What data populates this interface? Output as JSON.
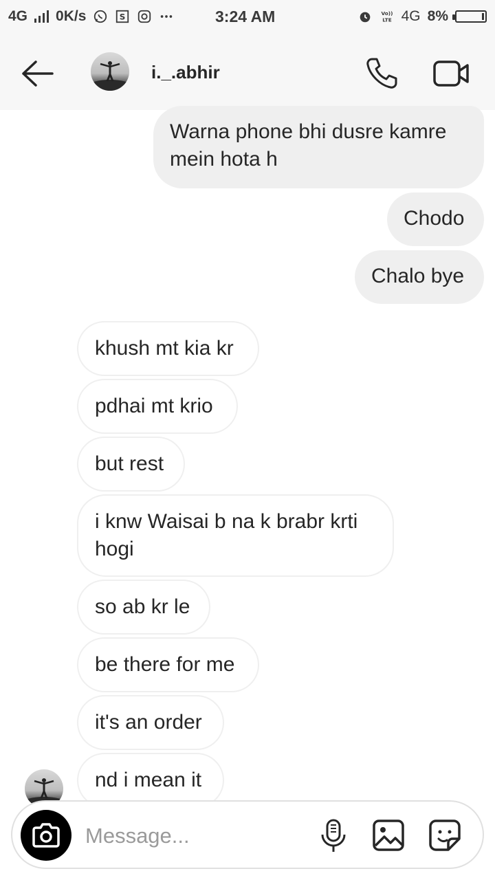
{
  "status_bar": {
    "network_left": "4G",
    "speed": "0K/s",
    "time": "3:24 AM",
    "volte": "VoLTE",
    "network_right": "4G",
    "battery": "8%"
  },
  "header": {
    "username": "i._.abhir"
  },
  "messages": [
    {
      "side": "sent",
      "text": "Warna phone bhi dusre kamre mein hota h"
    },
    {
      "side": "sent",
      "text": "Chodo"
    },
    {
      "side": "sent",
      "text": "Chalo bye"
    },
    {
      "side": "received",
      "text": "khush mt kia kr"
    },
    {
      "side": "received",
      "text": "pdhai mt krio"
    },
    {
      "side": "received",
      "text": "but rest"
    },
    {
      "side": "received",
      "text": "i knw Waisai b na k brabr krti hogi"
    },
    {
      "side": "received",
      "text": "so ab kr le"
    },
    {
      "side": "received",
      "text": "be there for me"
    },
    {
      "side": "received",
      "text": "it's an order"
    },
    {
      "side": "received",
      "text": "nd i mean it"
    }
  ],
  "composer": {
    "placeholder": "Message..."
  },
  "icons": {
    "back": "arrow-left-icon",
    "call": "phone-icon",
    "video": "video-camera-icon",
    "camera": "camera-icon",
    "mic": "microphone-icon",
    "gallery": "image-icon",
    "sticker": "sticker-icon"
  },
  "colors": {
    "sent_bubble": "#efefef",
    "received_border": "#efefef",
    "header_bg": "#f7f7f7",
    "text": "#262626"
  }
}
